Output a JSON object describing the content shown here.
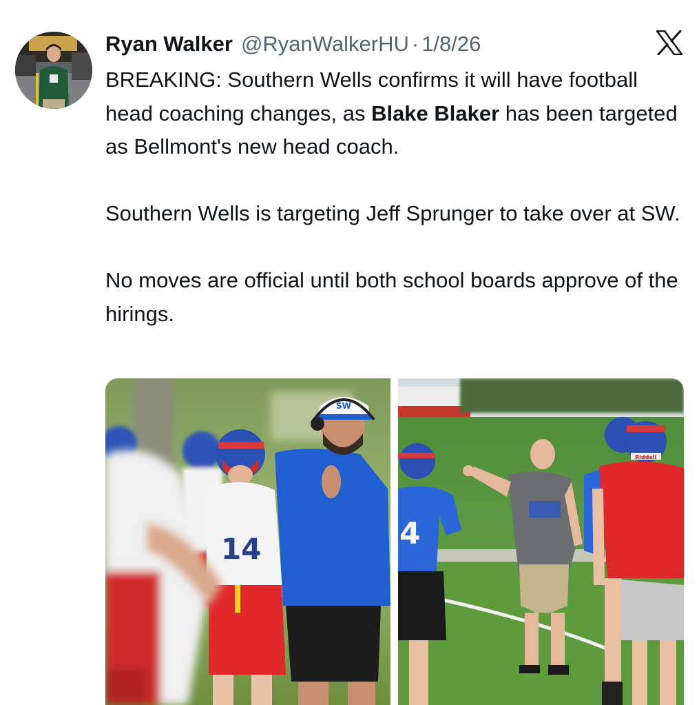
{
  "author": {
    "display_name": "Ryan Walker",
    "handle": "@RyanWalkerHU",
    "separator": "·",
    "date": "1/8/26"
  },
  "platform_icon": "x-logo-icon",
  "tweet": {
    "p1": {
      "before": "BREAKING: Southern Wells confirms it will have football head coaching changes, as ",
      "bold": "Blake Blaker",
      "after": " has been targeted as Bellmont's new head coach."
    },
    "p2": "Southern Wells is targeting Jeff Sprunger to take over at SW.",
    "p3": "No moves are official until both school boards approve of the hirings."
  },
  "media": {
    "left_photo": {
      "jersey_number": "14",
      "cap_logo": "SW"
    },
    "right_photo": {
      "jersey_number": "4",
      "helmet_brand": "Riddell"
    }
  },
  "colors": {
    "text": "#0f1419",
    "secondary": "#536471",
    "royal_blue": "#1f5fd0",
    "red": "#e0282b",
    "grass": "#4f8f3a"
  }
}
